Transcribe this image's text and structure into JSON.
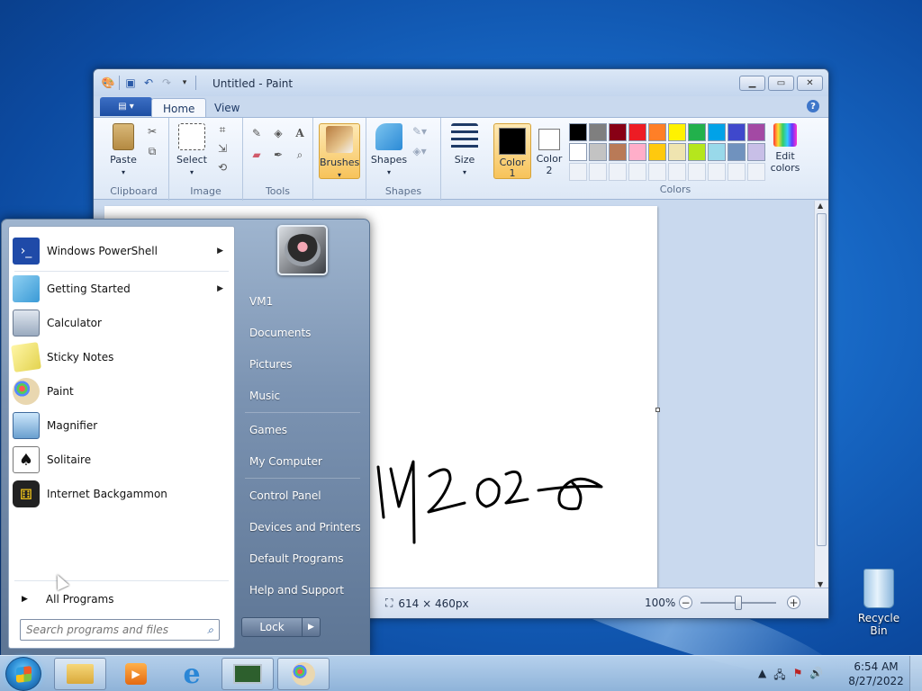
{
  "paint": {
    "title": "Untitled - Paint",
    "tabs": [
      "Home",
      "View"
    ],
    "groups": {
      "clipboard": "Clipboard",
      "image": "Image",
      "tools": "Tools",
      "shapes": "Shapes",
      "colors": "Colors"
    },
    "buttons": {
      "paste": "Paste",
      "select": "Select",
      "brushes": "Brushes",
      "shapes": "Shapes",
      "size": "Size",
      "color1_a": "Color",
      "color1_b": "1",
      "color2_a": "Color",
      "color2_b": "2",
      "edit_colors_a": "Edit",
      "edit_colors_b": "colors"
    },
    "color1": "#000000",
    "color2": "#ffffff",
    "palette_row1": [
      "#000000",
      "#7f7f7f",
      "#880015",
      "#ed1c24",
      "#ff7f27",
      "#fff200",
      "#22b14c",
      "#00a2e8",
      "#3f48cc",
      "#a349a4"
    ],
    "palette_row2": [
      "#ffffff",
      "#c3c3c3",
      "#b97a57",
      "#ffaec9",
      "#ffc90e",
      "#efe4b0",
      "#b5e61d",
      "#99d9ea",
      "#7092be",
      "#c8bfe7"
    ],
    "canvas_text": "11/2020",
    "status": {
      "dimensions": "614 × 460px",
      "zoom": "100%"
    }
  },
  "startmenu": {
    "programs": [
      {
        "label": "Windows PowerShell",
        "icon": "powershell-icon",
        "has_arrow": true
      },
      {
        "label": "Getting Started",
        "icon": "getting-started-icon",
        "has_arrow": true
      },
      {
        "label": "Calculator",
        "icon": "calculator-icon",
        "has_arrow": false
      },
      {
        "label": "Sticky Notes",
        "icon": "sticky-notes-icon",
        "has_arrow": false
      },
      {
        "label": "Paint",
        "icon": "paint-palette-icon",
        "has_arrow": false
      },
      {
        "label": "Magnifier",
        "icon": "magnifier-icon",
        "has_arrow": false
      },
      {
        "label": "Solitaire",
        "icon": "solitaire-icon",
        "has_arrow": false
      },
      {
        "label": "Internet Backgammon",
        "icon": "backgammon-icon",
        "has_arrow": false
      }
    ],
    "all_programs": "All Programs",
    "search_placeholder": "Search programs and files",
    "right_links": [
      "VM1",
      "Documents",
      "Pictures",
      "Music",
      "Games",
      "My Computer",
      "Control Panel",
      "Devices and Printers",
      "Default Programs",
      "Help and Support"
    ],
    "lock": "Lock"
  },
  "desktop": {
    "recycle_bin": "Recycle Bin"
  },
  "taskbar": {
    "time": "6:54 AM",
    "date": "8/27/2022"
  }
}
